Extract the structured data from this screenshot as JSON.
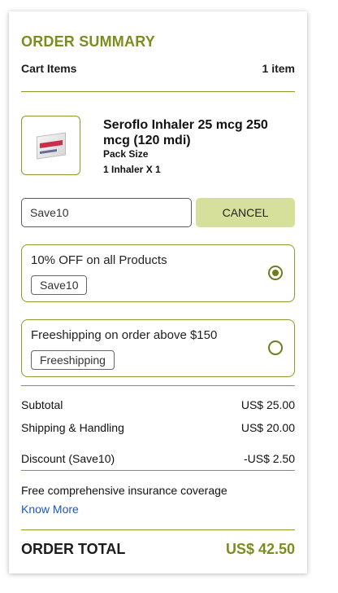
{
  "summary": {
    "title": "ORDER SUMMARY",
    "cart_label": "Cart Items",
    "cart_count": "1 item"
  },
  "product": {
    "name": "Seroflo Inhaler 25 mcg 250 mcg (120 mdi)",
    "pack_size_label": "Pack Size",
    "pack_size_value": "1 Inhaler X 1",
    "image_icon": "inhaler-box-icon"
  },
  "coupon": {
    "input_value": "Save10",
    "cancel_label": "CANCEL"
  },
  "offers": [
    {
      "text": "10% OFF on all Products",
      "code": "Save10",
      "selected": true
    },
    {
      "text": "Freeshipping on order above $150",
      "code": "Freeshipping",
      "selected": false
    }
  ],
  "totals": {
    "subtotal_label": "Subtotal",
    "subtotal_value": "US$ 25.00",
    "shipping_label": "Shipping & Handling",
    "shipping_value": "US$ 20.00",
    "discount_label": "Discount (Save10)",
    "discount_value": "-US$ 2.50",
    "insurance_text": "Free comprehensive insurance coverage",
    "know_more": "Know More",
    "order_total_label": "ORDER TOTAL",
    "order_total_value": "US$ 42.50"
  },
  "colors": {
    "accent": "#7d8c1e",
    "cancel_bg": "#d6e09a",
    "link": "#1a56c9"
  }
}
